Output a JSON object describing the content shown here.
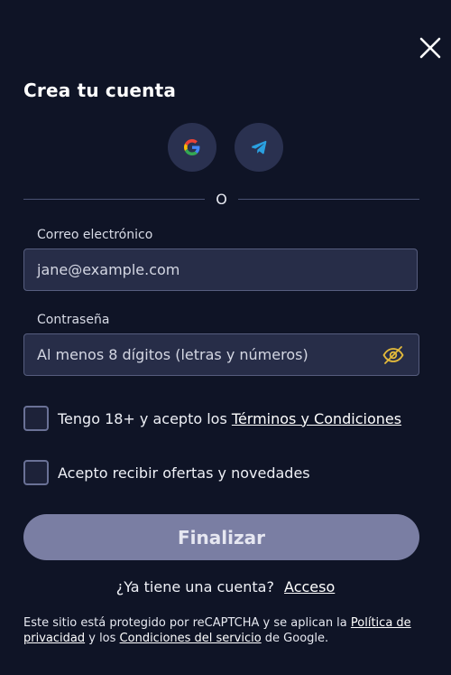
{
  "title": "Crea tu cuenta",
  "divider_text": "O",
  "email": {
    "label": "Correo electrónico",
    "value": "jane@example.com"
  },
  "password": {
    "label": "Contraseña",
    "placeholder": "Al menos 8 dígitos (letras y números)"
  },
  "terms": {
    "text": "Tengo 18+ y acepto los ",
    "link": "Términos y Condiciones"
  },
  "offers": {
    "text": "Acepto recibir ofertas y novedades"
  },
  "submit_label": "Finalizar",
  "account": {
    "question": "¿Ya tiene una cuenta?",
    "link": "Acceso"
  },
  "recaptcha": {
    "prefix": "Este sitio está protegido por reCAPTCHA y se aplican la ",
    "privacy_link": "Política de privacidad",
    "middle": " y los ",
    "terms_link": "Condiciones del servicio",
    "suffix": " de Google."
  },
  "icons": {
    "close": "close-icon",
    "google": "google-icon",
    "telegram": "telegram-icon",
    "eye": "eye-off-icon"
  },
  "colors": {
    "background": "#0f1426",
    "input_bg": "#272d48",
    "button_bg": "#7a7ea3",
    "accent": "#e2b93b"
  }
}
